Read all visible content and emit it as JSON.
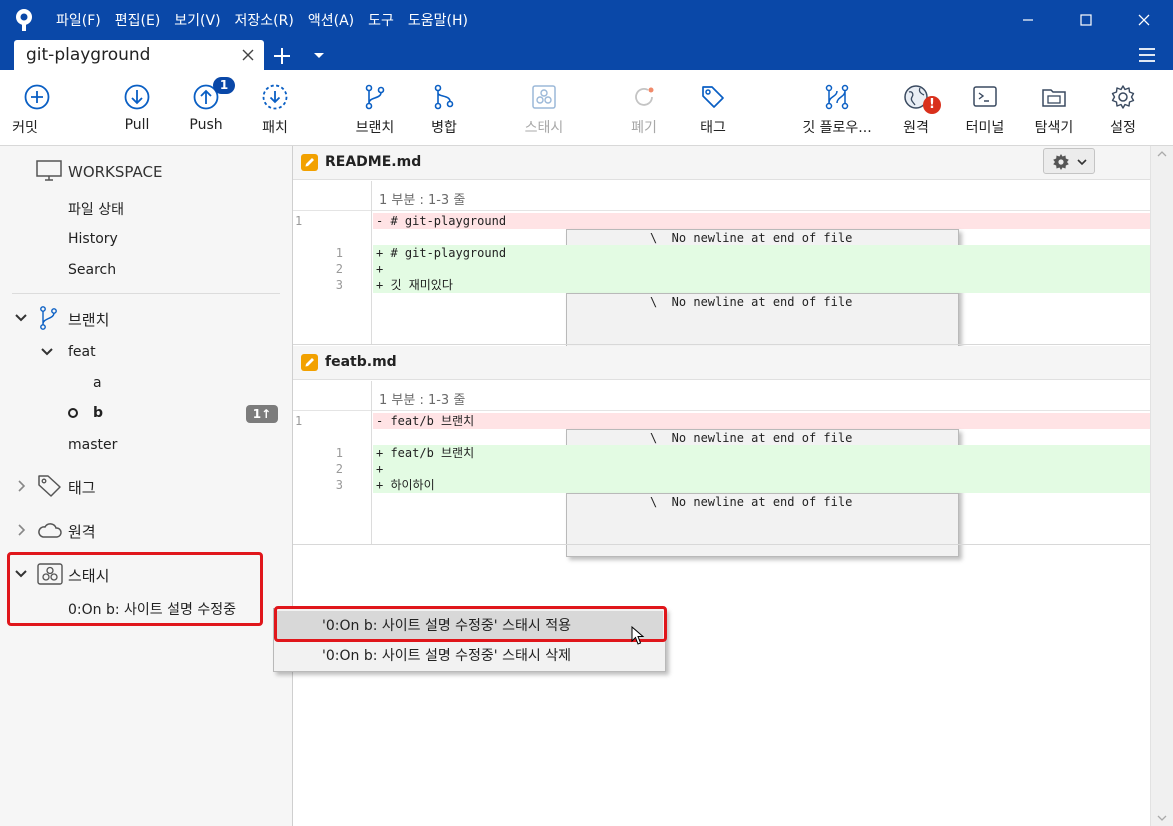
{
  "menu": {
    "items": [
      "파일(F)",
      "편집(E)",
      "보기(V)",
      "저장소(R)",
      "액션(A)",
      "도구",
      "도움말(H)"
    ]
  },
  "tab": {
    "title": "git-playground"
  },
  "toolbar": {
    "commit": "커밋",
    "pull": "Pull",
    "push": "Push",
    "push_badge": "1",
    "fetch": "패치",
    "branch": "브랜치",
    "merge": "병합",
    "stash": "스태시",
    "discard": "폐기",
    "tag": "태그",
    "gitflow": "깃 플로우...",
    "remote": "원격",
    "remote_alert": "!",
    "terminal": "터미널",
    "explorer": "탐색기",
    "settings": "설정"
  },
  "sidebar": {
    "workspace": "WORKSPACE",
    "file_status": "파일 상태",
    "history": "History",
    "search": "Search",
    "branches": "브랜치",
    "feat": "feat",
    "branch_a": "a",
    "branch_b": "b",
    "branch_b_badge": "1↑",
    "master": "master",
    "tags": "태그",
    "remotes": "원격",
    "stashes": "스태시",
    "stash_item": "0:On b: 사이트 설명 수정중"
  },
  "files": [
    {
      "name": "README.md",
      "hunk": "1 부분 : 1-3 줄",
      "lines": [
        {
          "type": "del",
          "old": "1",
          "new": "",
          "text": "- # git-playground"
        },
        {
          "type": "ctx",
          "old": "",
          "new": "",
          "text": "\\  No newline at end of file"
        },
        {
          "type": "add",
          "old": "",
          "new": "1",
          "text": "+ # git-playground"
        },
        {
          "type": "add",
          "old": "",
          "new": "2",
          "text": "+"
        },
        {
          "type": "add",
          "old": "",
          "new": "3",
          "text": "+ 깃 재미있다"
        },
        {
          "type": "ctx",
          "old": "",
          "new": "",
          "text": "\\  No newline at end of file"
        }
      ]
    },
    {
      "name": "featb.md",
      "hunk": "1 부분 : 1-3 줄",
      "lines": [
        {
          "type": "del",
          "old": "1",
          "new": "",
          "text": "- feat/b 브랜치"
        },
        {
          "type": "ctx",
          "old": "",
          "new": "",
          "text": "\\  No newline at end of file"
        },
        {
          "type": "add",
          "old": "",
          "new": "1",
          "text": "+ feat/b 브랜치"
        },
        {
          "type": "add",
          "old": "",
          "new": "2",
          "text": "+"
        },
        {
          "type": "add",
          "old": "",
          "new": "3",
          "text": "+ 하이하이"
        },
        {
          "type": "ctx",
          "old": "",
          "new": "",
          "text": "\\  No newline at end of file"
        }
      ]
    }
  ],
  "context_menu": {
    "apply": "'0:On b: 사이트 설명 수정중' 스태시 적용",
    "delete": "'0:On b: 사이트 설명 수정중' 스태시 삭제"
  },
  "colors": {
    "titlebar": "#0a48a8",
    "highlight": "#e0161b",
    "diff_del": "#ffe3e5",
    "diff_add": "#e3fbe3",
    "file_icon": "#f2a100"
  }
}
